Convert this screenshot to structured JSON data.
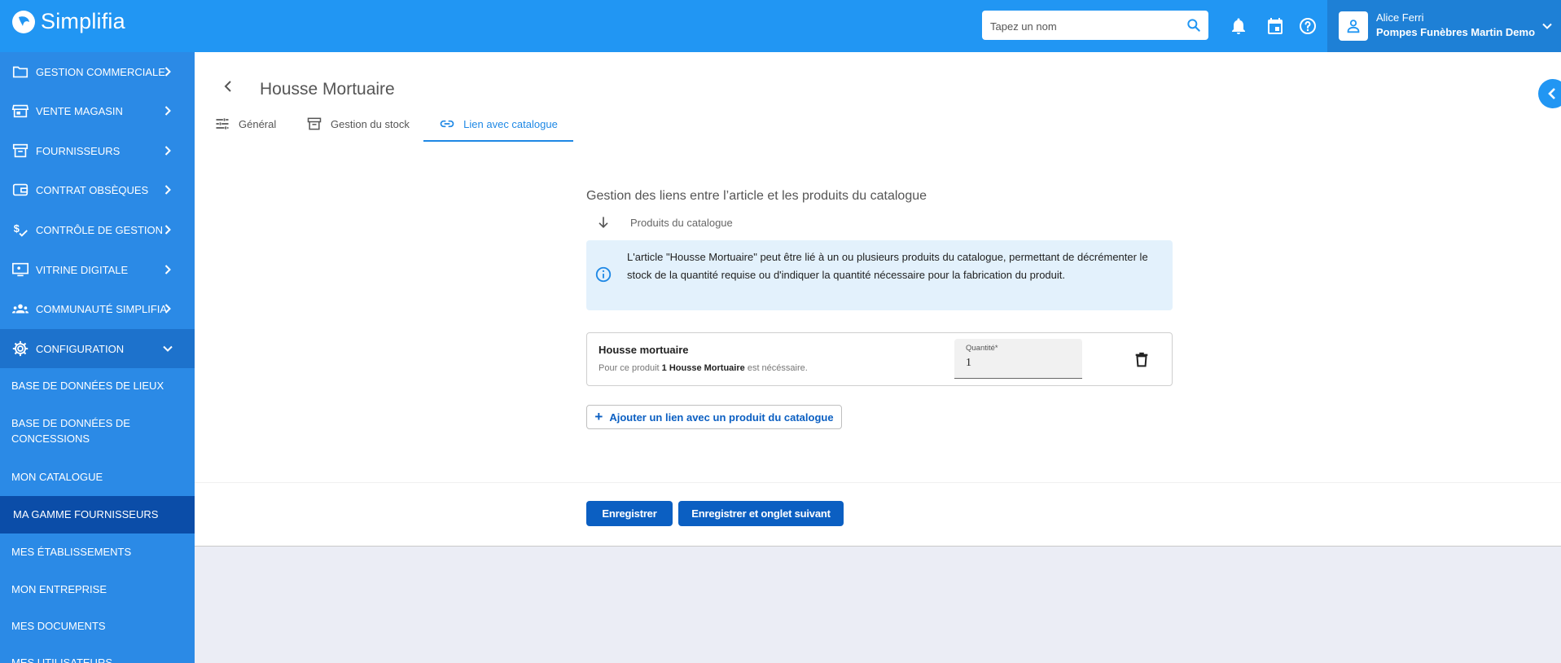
{
  "app": {
    "name": "Simplifia",
    "brand_color": "#2196f3"
  },
  "topbar": {
    "search_placeholder": "Tapez un nom",
    "user": {
      "name": "Alice Ferri",
      "company": "Pompes Funèbres Martin Demo"
    },
    "icons": [
      "search-icon",
      "bell-icon",
      "calendar-icon",
      "help-icon",
      "user-icon",
      "chevron-down-icon"
    ]
  },
  "sidebar": {
    "items": [
      {
        "label": "GESTION COMMERCIALE",
        "icon": "folder-icon"
      },
      {
        "label": "VENTE MAGASIN",
        "icon": "store-icon"
      },
      {
        "label": "FOURNISSEURS",
        "icon": "archive-icon"
      },
      {
        "label": "CONTRAT OBSÈQUES",
        "icon": "wallet-icon"
      },
      {
        "label": "CONTRÔLE DE GESTION",
        "icon": "money-check-icon"
      },
      {
        "label": "VITRINE DIGITALE",
        "icon": "screen-icon"
      },
      {
        "label": "COMMUNAUTÉ SIMPLIFIA",
        "icon": "group-icon"
      },
      {
        "label": "CONFIGURATION",
        "icon": "gear-icon"
      }
    ],
    "sub_items": [
      {
        "label": "BASE DE DONNÉES DE LIEUX"
      },
      {
        "label": "BASE DE DONNÉES DE CONCESSIONS"
      },
      {
        "label": "MON CATALOGUE"
      },
      {
        "label": "MA GAMME FOURNISSEURS",
        "active": true
      },
      {
        "label": "MES ÉTABLISSEMENTS"
      },
      {
        "label": "MON ENTREPRISE"
      },
      {
        "label": "MES DOCUMENTS"
      },
      {
        "label": "MES UTILISATEURS"
      }
    ]
  },
  "page": {
    "title": "Housse Mortuaire",
    "tabs": [
      {
        "label": "Général",
        "icon": "tune-icon"
      },
      {
        "label": "Gestion du stock",
        "icon": "archive-icon"
      },
      {
        "label": "Lien avec catalogue",
        "icon": "link-icon",
        "active": true
      }
    ]
  },
  "section": {
    "title": "Gestion des liens entre l’article et les produits du catalogue",
    "subtitle": "Produits du catalogue",
    "info_text": "L'article \"Housse Mortuaire\" peut être lié à un ou plusieurs produits du catalogue, permettant de décrémenter le stock de la quantité requise ou d'indiquer la quantité nécessaire pour la fabrication du produit."
  },
  "linked_product": {
    "name": "Housse mortuaire",
    "desc_prefix": "Pour ce produit",
    "desc_bold": "1 Housse Mortuaire",
    "desc_suffix": "est nécéssaire.",
    "quantity_label": "Quantité",
    "quantity_required_mark": "*",
    "quantity_value": "1"
  },
  "actions": {
    "add_link": "Ajouter un lien avec un produit du catalogue",
    "save": "Enregistrer",
    "save_next": "Enregistrer et onglet suivant"
  }
}
